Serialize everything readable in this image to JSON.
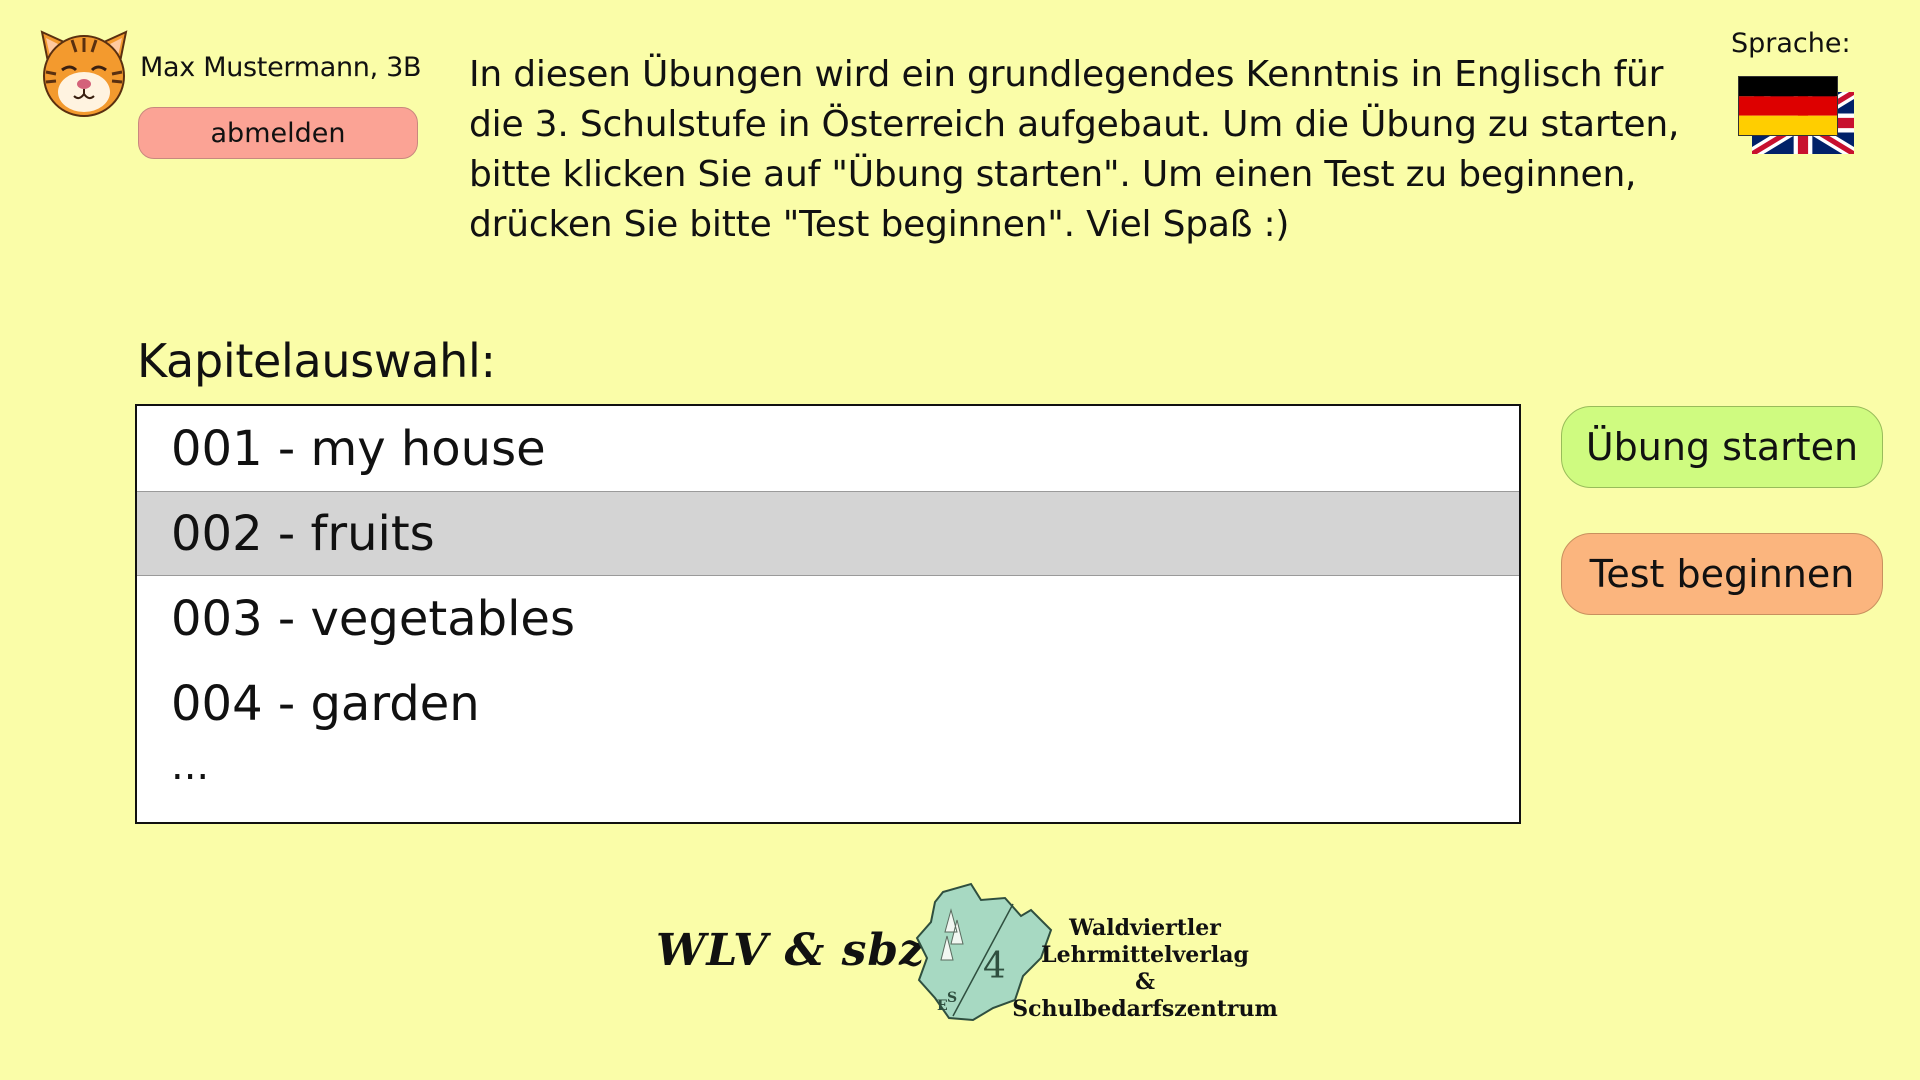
{
  "user": {
    "name": "Max Mustermann, 3B",
    "logout_label": "abmelden"
  },
  "intro_text": "In diesen Übungen wird ein grundlegendes Kenntnis in Englisch für die 3. Schulstufe in Österreich aufgebaut. Um die Übung zu starten, bitte klicken Sie auf \"Übung starten\". Um einen Test zu beginnen, drücken Sie bitte \"Test beginnen\". Viel Spaß :)",
  "language": {
    "label": "Sprache:",
    "current": "german-flag-icon",
    "alternate": "uk-flag-icon"
  },
  "chapters": {
    "heading": "Kapitelauswahl:",
    "items": [
      {
        "label": "001 - my house"
      },
      {
        "label": "002 - fruits"
      },
      {
        "label": "003 - vegetables"
      },
      {
        "label": "004 - garden"
      }
    ],
    "selected": "002 - fruits",
    "more": "..."
  },
  "actions": {
    "start_exercise": "Übung starten",
    "start_test": "Test beginnen"
  },
  "footer": {
    "wlv_logo": "WLV & sbz",
    "publisher_line1": "Waldviertler",
    "publisher_line2": "Lehrmittelverlag",
    "publisher_amp": "&",
    "publisher_line3": "Schulbedarfszentrum"
  },
  "colors": {
    "background": "#FAFDA8",
    "logout_button": "#FBA395",
    "start_button": "#CFFB80",
    "test_button": "#FBB57E",
    "selected_row": "#D4D4D4"
  }
}
